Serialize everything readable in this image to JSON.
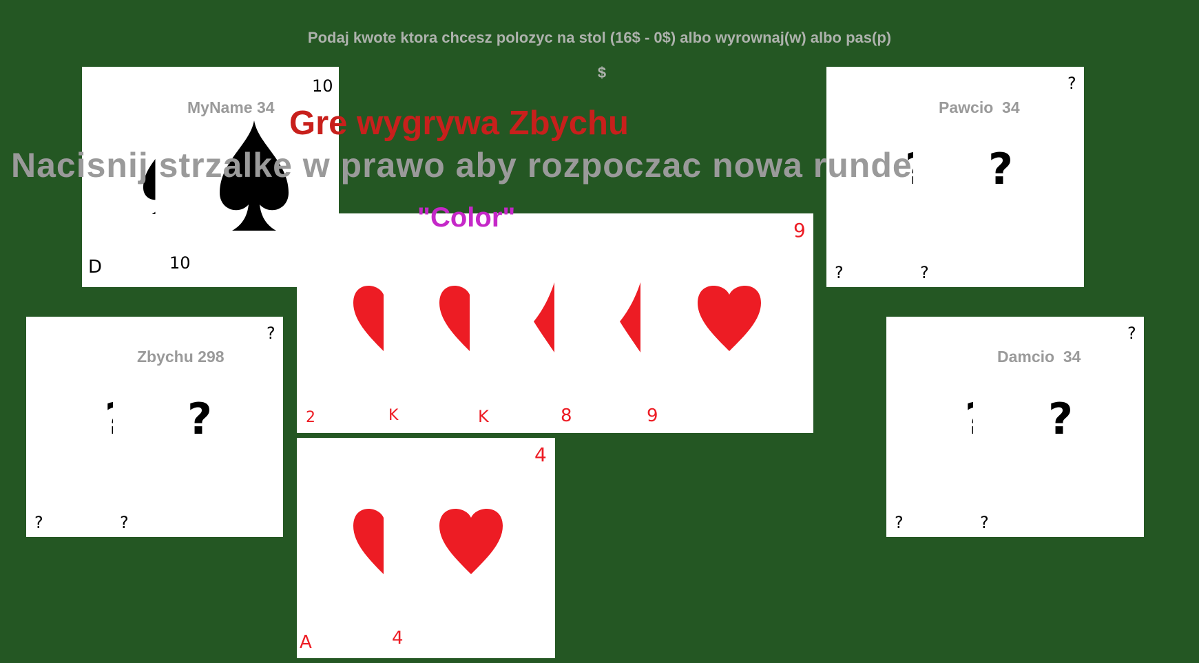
{
  "prompt": "Podaj kwote ktora chcesz polozyc na stol (16$ - 0$) albo wyrownaj(w) albo pas(p)",
  "bet_input": "$",
  "players": {
    "me": {
      "name": "MyName 34",
      "card1_rank": "D",
      "card2_rank": "10",
      "card_top_rank": "10",
      "suit": "spade"
    },
    "zbychu": {
      "name": "Zbychu 298",
      "hidden": "?"
    },
    "pawcio": {
      "name": "Pawcio  34",
      "hidden": "?"
    },
    "damcio": {
      "name": "Damcio  34",
      "hidden": "?"
    }
  },
  "table": {
    "top_rank": "9",
    "ranks": [
      "2",
      "K",
      "K",
      "8",
      "9"
    ],
    "suit": "heart"
  },
  "bottom_hand": {
    "top_rank": "4",
    "ranks": [
      "A",
      "4"
    ],
    "suit": "heart"
  },
  "winner_text": "Gre wygrywa Zbychu",
  "new_round_text": "Nacisnij strzalke w prawo aby rozpoczac nowa runde",
  "hand_name": "\"Color\"",
  "colors": {
    "background": "#245723",
    "red": "#ed1c24",
    "winner": "#c8201c",
    "hand": "#c528c8",
    "gray": "#9a9a9a"
  }
}
